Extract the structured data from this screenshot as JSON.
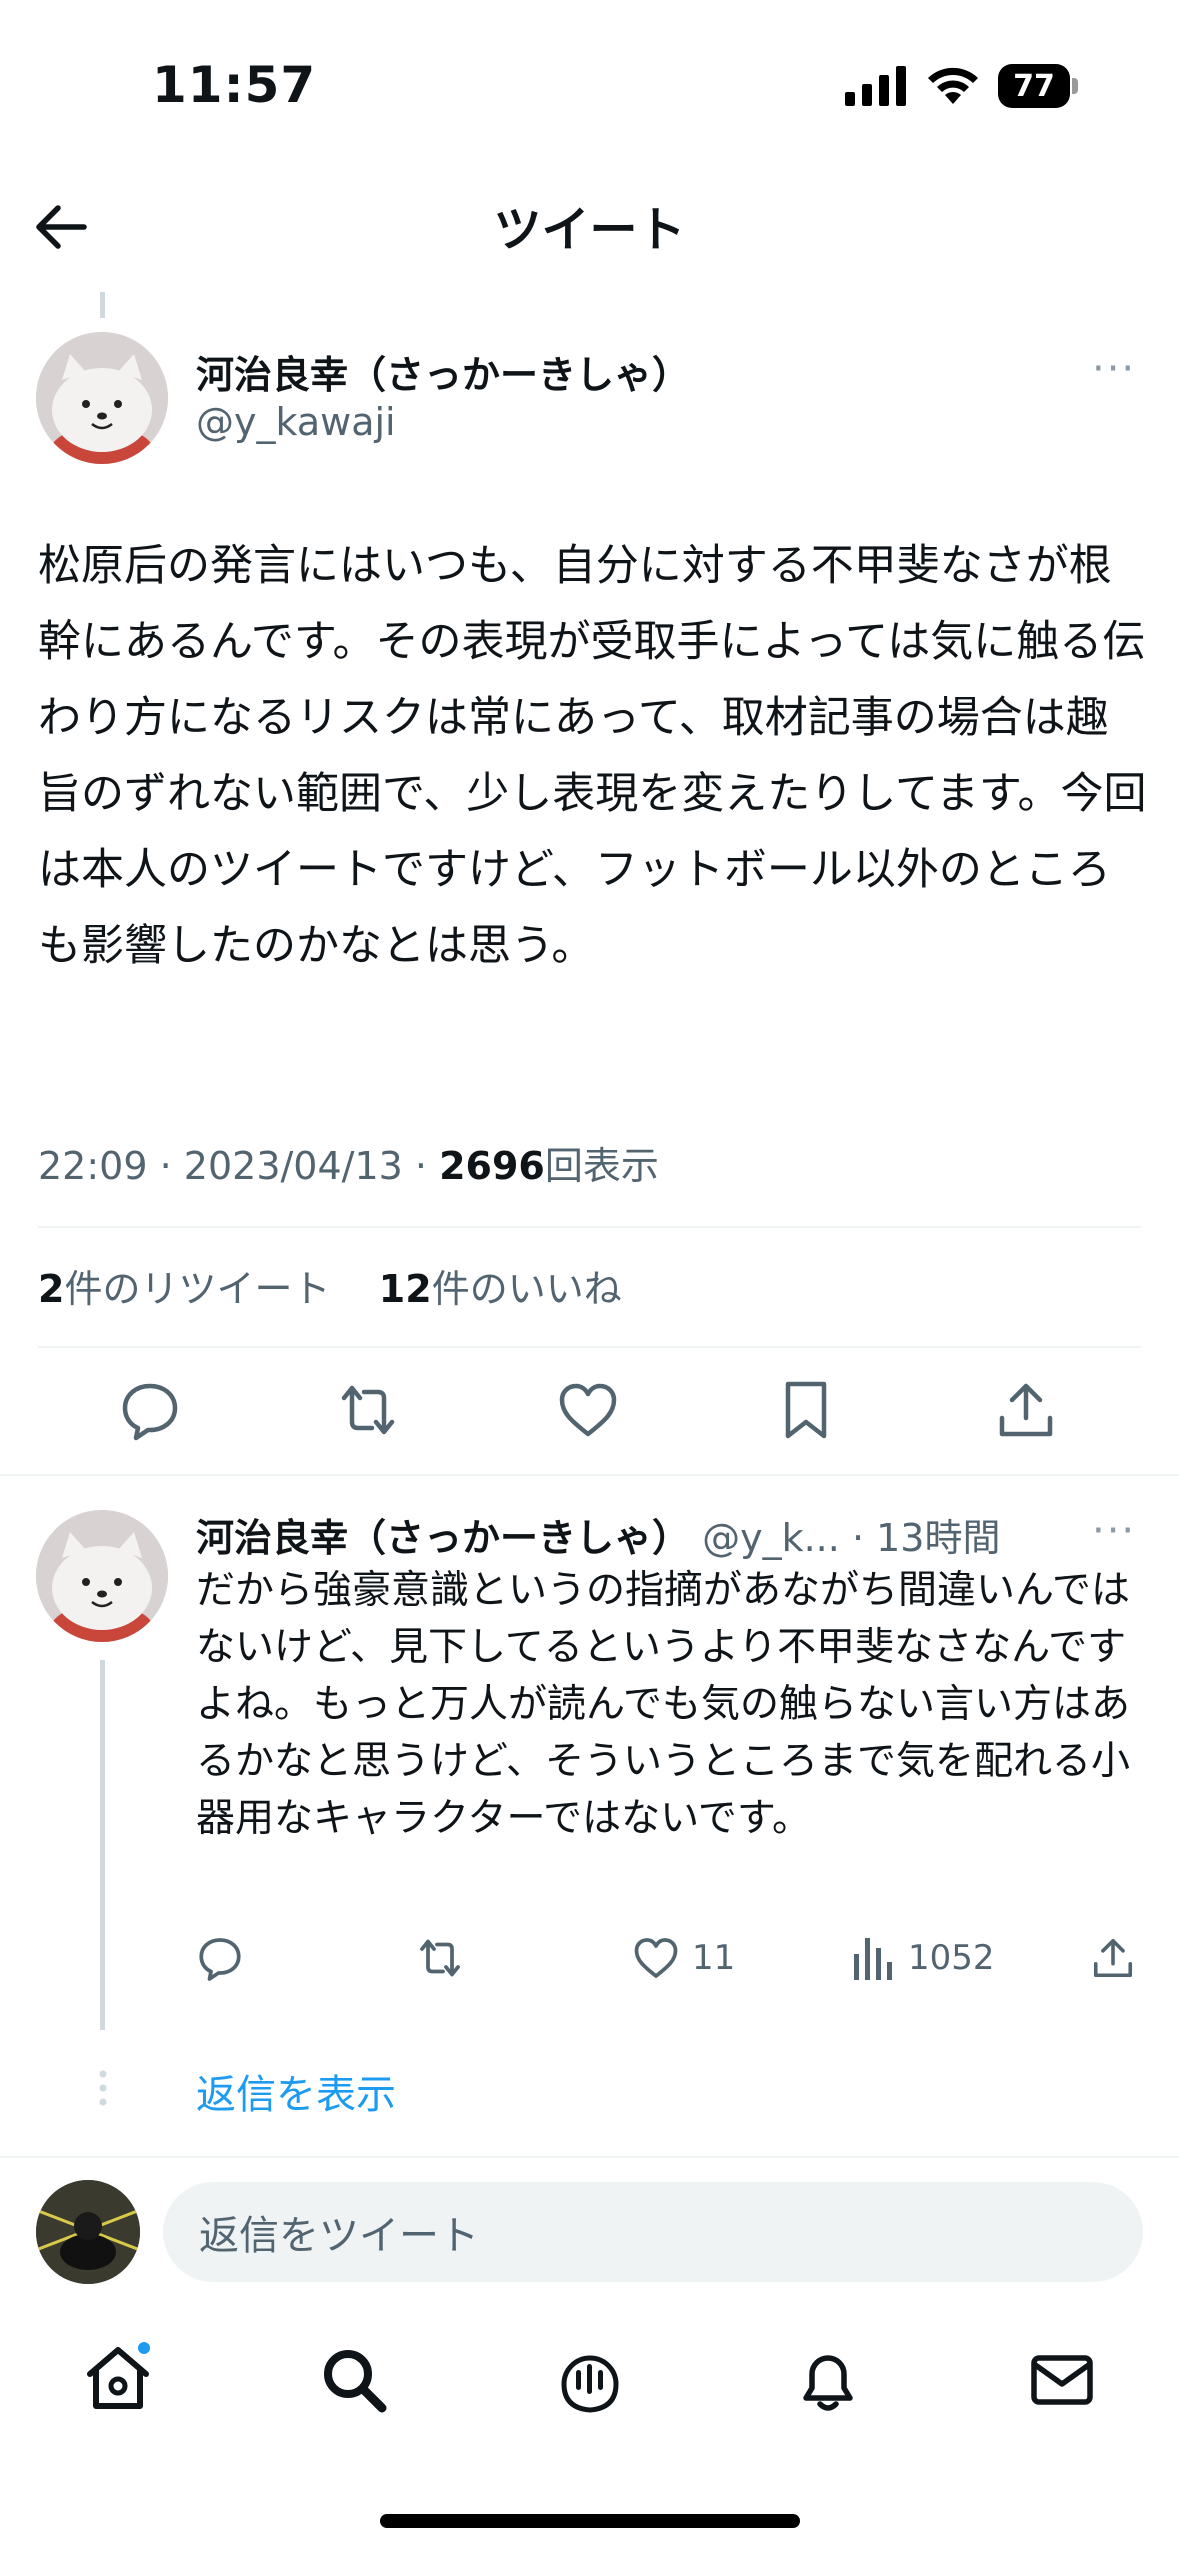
{
  "status_bar": {
    "time": "11:57",
    "battery": "77"
  },
  "header": {
    "title": "ツイート"
  },
  "tweet": {
    "author_name": "河治良幸（さっかーきしゃ）",
    "author_handle": "@y_kawaji",
    "body": "松原后の発言にはいつも、自分に対する不甲斐なさが根幹にあるんです。その表現が受取手によっては気に触る伝わり方になるリスクは常にあって、取材記事の場合は趣旨のずれない範囲で、少し表現を変えたりしてます。今回は本人のツイートですけど、フットボール以外のところも影響したのかなとは思う。",
    "time": "22:09",
    "date": "2023/04/13",
    "separator": "·",
    "views_count": "2696",
    "views_label": "回表示",
    "retweets_count": "2",
    "retweets_label": "件のリツイート",
    "likes_count": "12",
    "likes_label": "件のいいね",
    "more_label": "···"
  },
  "reply": {
    "author_name": "河治良幸（さっかーきしゃ）",
    "author_handle": "@y_k...",
    "time_ago": "· 13時間",
    "body": "だから強豪意識というの指摘があながち間違いんではないけど、見下してるというより不甲斐なさなんですよね。もっと万人が読んでも気の触らない言い方はあるかなと思うけど、そういうところまで気を配れる小器用なキャラクターではないです。",
    "likes": "11",
    "views": "1052",
    "more_label": "···"
  },
  "show_replies": "返信を表示",
  "compose": {
    "placeholder": "返信をツイート"
  },
  "colors": {
    "accent": "#1d9bf0",
    "text": "#0f1419",
    "secondary": "#536471",
    "divider": "#eff3f4"
  },
  "icons": [
    "back-arrow-icon",
    "reply-icon",
    "retweet-icon",
    "like-icon",
    "bookmark-icon",
    "share-icon",
    "views-icon",
    "home-icon",
    "search-icon",
    "spaces-icon",
    "notifications-icon",
    "messages-icon"
  ]
}
